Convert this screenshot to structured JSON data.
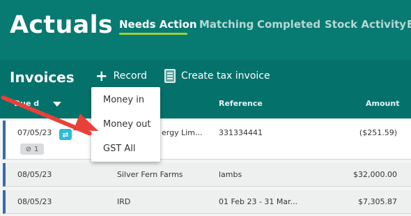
{
  "header": {
    "title": "Actuals",
    "tabs": [
      {
        "label": "Needs Action",
        "active": true
      },
      {
        "label": "Matching"
      },
      {
        "label": "Completed"
      },
      {
        "label": "Stock Activity"
      },
      {
        "label": "E"
      }
    ]
  },
  "toolbar": {
    "section_title": "Invoices",
    "record_label": "Record",
    "create_tax_invoice_label": "Create tax invoice"
  },
  "table": {
    "columns": {
      "due": "Due d",
      "reference": "Reference",
      "amount": "Amount"
    },
    "rows": [
      {
        "date": "07/05/23",
        "contact": "ergy Lim...",
        "reference": "331334441",
        "amount": "($251.59)",
        "attachments": "1"
      },
      {
        "date": "08/05/23",
        "contact": "Silver Fern Farms",
        "reference": "lambs",
        "amount": "$32,000.00"
      },
      {
        "date": "08/05/23",
        "contact": "IRD",
        "reference": "01 Feb 23 - 31 Mar...",
        "amount": "$7,305.87"
      }
    ]
  },
  "record_menu": {
    "items": [
      "Money in",
      "Money out",
      "GST All"
    ]
  },
  "colors": {
    "header_bg": "#077a72",
    "subheader_bg": "#04726b",
    "active_tab_underline": "#9bd03a",
    "row_accent": "#3b68b5",
    "annotation_arrow": "#e8413a",
    "sync_badge": "#2dbbd6"
  }
}
